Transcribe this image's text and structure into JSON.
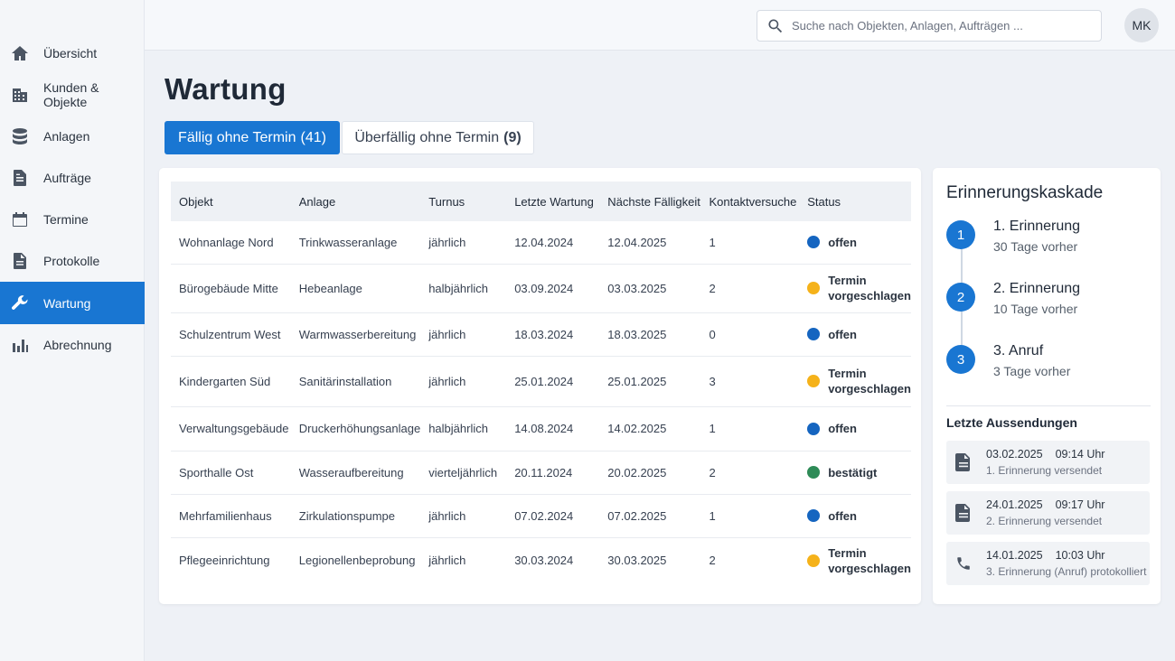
{
  "nav": [
    {
      "label": "Übersicht",
      "icon": "home-icon"
    },
    {
      "label": "Kunden & Objekte",
      "icon": "building-icon"
    },
    {
      "label": "Anlagen",
      "icon": "database-icon"
    },
    {
      "label": "Aufträge",
      "icon": "document-icon"
    },
    {
      "label": "Termine",
      "icon": "calendar-icon"
    },
    {
      "label": "Protokolle",
      "icon": "file-icon"
    },
    {
      "label": "Wartung",
      "icon": "wrench-icon",
      "active": true
    },
    {
      "label": "Abrechnung",
      "icon": "bar-chart-icon"
    }
  ],
  "search": {
    "placeholder": "Suche nach Objekten, Anlagen, Aufträgen ..."
  },
  "user": {
    "initials": "MK"
  },
  "page": {
    "title": "Wartung"
  },
  "tabs": [
    {
      "label": "Fällig ohne Termin",
      "count": "(41)"
    },
    {
      "label": "Überfällig ohne Termin",
      "count": "(9)"
    }
  ],
  "table": {
    "columns": [
      "Objekt",
      "Anlage",
      "Turnus",
      "Letzte Wartung",
      "Nächste Fälligkeit",
      "Kontaktversuche",
      "Status"
    ],
    "rows": [
      {
        "objekt": "Wohnanlage Nord",
        "anlage": "Trinkwasseranlage",
        "turnus": "jährlich",
        "letzte": "12.04.2024",
        "naechste": "12.04.2025",
        "kontakt": "1",
        "status": "offen"
      },
      {
        "objekt": "Bürogebäude Mitte",
        "anlage": "Hebeanlage",
        "turnus": "halbjährlich",
        "letzte": "03.09.2024",
        "naechste": "03.03.2025",
        "kontakt": "2",
        "status": "Termin vorgeschlagen"
      },
      {
        "objekt": "Schulzentrum West",
        "anlage": "Warmwasserbereitung",
        "turnus": "jährlich",
        "letzte": "18.03.2024",
        "naechste": "18.03.2025",
        "kontakt": "0",
        "status": "offen"
      },
      {
        "objekt": "Kindergarten Süd",
        "anlage": "Sanitärinstallation",
        "turnus": "jährlich",
        "letzte": "25.01.2024",
        "naechste": "25.01.2025",
        "kontakt": "3",
        "status": "Termin vorgeschlagen"
      },
      {
        "objekt": "Verwaltungsgebäude",
        "anlage": "Druckerhöhungsanlage",
        "turnus": "halbjährlich",
        "letzte": "14.08.2024",
        "naechste": "14.02.2025",
        "kontakt": "1",
        "status": "offen"
      },
      {
        "objekt": "Sporthalle Ost",
        "anlage": "Wasseraufbereitung",
        "turnus": "vierteljährlich",
        "letzte": "20.11.2024",
        "naechste": "20.02.2025",
        "kontakt": "2",
        "status": "bestätigt"
      },
      {
        "objekt": "Mehrfamilienhaus",
        "anlage": "Zirkulationspumpe",
        "turnus": "jährlich",
        "letzte": "07.02.2024",
        "naechste": "07.02.2025",
        "kontakt": "1",
        "status": "offen"
      },
      {
        "objekt": "Pflegeeinrichtung",
        "anlage": "Legionellenbeprobung",
        "turnus": "jährlich",
        "letzte": "30.03.2024",
        "naechste": "30.03.2025",
        "kontakt": "2",
        "status": "Termin vorgeschlagen"
      }
    ]
  },
  "status_colors": {
    "offen": "#1565c0",
    "Termin vorgeschlagen": "#f5b21a",
    "bestätigt": "#2e8b57"
  },
  "cascade": {
    "title": "Erinnerungskaskade",
    "steps": [
      {
        "num": "1",
        "title": "1. Erinnerung",
        "sub": "30 Tage vorher"
      },
      {
        "num": "2",
        "title": "2. Erinnerung",
        "sub": "10 Tage vorher"
      },
      {
        "num": "3",
        "title": "3. Anruf",
        "sub": "3 Tage vorher"
      }
    ],
    "recent_title": "Letzte Aussendungen",
    "recent": [
      {
        "date": "03.02.2025",
        "time": "09:14 Uhr",
        "desc": "1. Erinnerung versendet",
        "icon": "document-icon"
      },
      {
        "date": "24.01.2025",
        "time": "09:17 Uhr",
        "desc": "2. Erinnerung versendet",
        "icon": "document-icon"
      },
      {
        "date": "14.01.2025",
        "time": "10:03 Uhr",
        "desc": "3. Erinnerung (Anruf) protokolliert",
        "icon": "phone-icon"
      }
    ]
  },
  "colors": {
    "accent": "#1976d2"
  }
}
